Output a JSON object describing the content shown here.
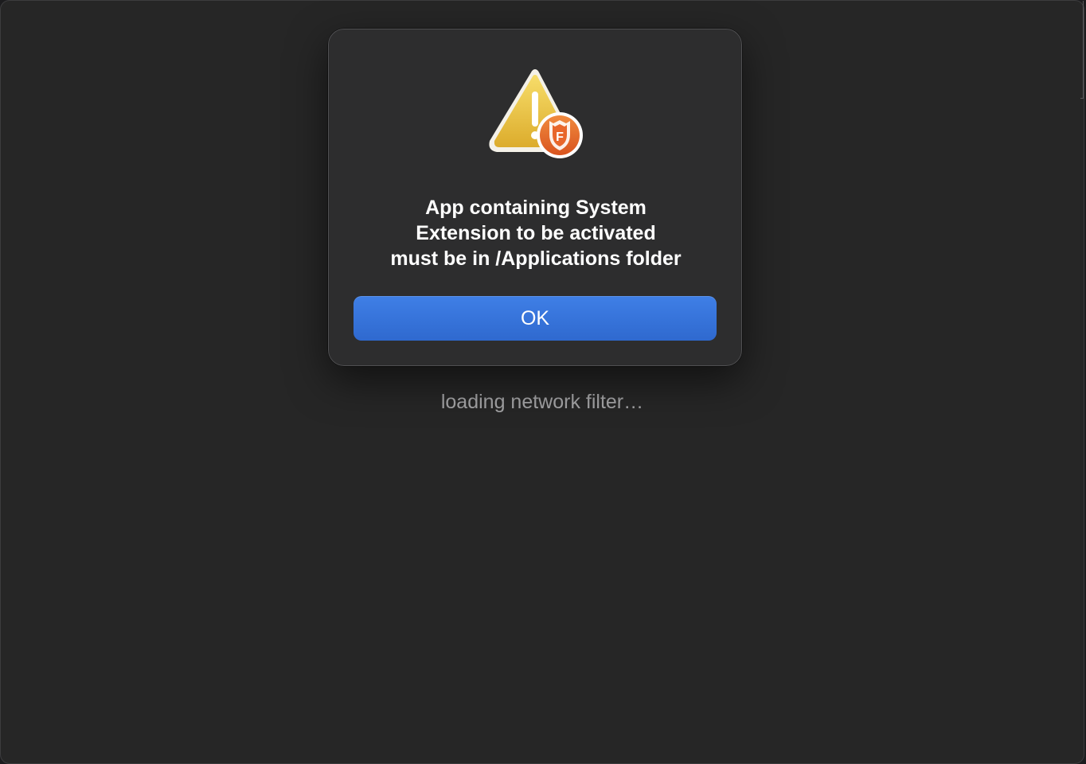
{
  "alert": {
    "message": "App containing System\nExtension to be activated\nmust be in /Applications folder",
    "ok_label": "OK",
    "icon": "warning-triangle-icon",
    "badge_icon": "app-shield-badge-icon",
    "badge_letter": "F"
  },
  "status": {
    "loading_text": "loading network filter…"
  },
  "colors": {
    "window_bg": "#262626",
    "alert_bg": "#2d2d2e",
    "button_accent": "#3a76de",
    "warning_yellow": "#f2c94c",
    "badge_orange": "#e6692e",
    "secondary_text": "#a4a4a6"
  }
}
